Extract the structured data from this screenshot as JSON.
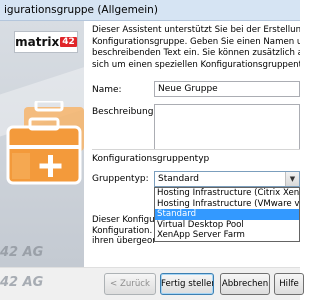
{
  "window": {
    "title": "igurationsgruppe (Allgemein)"
  },
  "sidebar": {
    "logo_text": "matrix",
    "logo_badge": "42",
    "company": "42 AG",
    "icon": "briefcase-add-icon",
    "accent_color": "#f39a3b"
  },
  "content": {
    "description_lines": [
      "Dieser Assistent unterstützt Sie bei der Erstellung einer neu",
      "Konfigurationsgruppe. Geben Sie einen Namen und optional d",
      "beschreibenden Text ein. Sie können zusätzlich auswählen, o",
      "sich um einen speziellen Konfigurationsgruppentyp handelt."
    ],
    "name_label": "Name:",
    "name_value": "Neue Gruppe",
    "description_label": "Beschreibung:",
    "description_value": "",
    "section_title": "Konfigurationsgruppentyp",
    "group_type_label": "Gruppentyp:",
    "group_type_selected": "Standard",
    "group_type_options": [
      "Hosting Infrastructure (Citrix XenServer)",
      "Hosting Infrastructure (VMware vSphere)",
      "Standard",
      "Virtual Desktop Pool",
      "XenApp Server Farm"
    ],
    "note_lines": [
      "Dieser Konfigurati",
      "Konfiguration. Unt",
      "ihren übergeordne"
    ]
  },
  "footer": {
    "company": "42 AG",
    "back_label": "< Zurück",
    "finish_label": "Fertig stellen",
    "cancel_label": "Abbrechen",
    "help_label": "Hilfe"
  }
}
